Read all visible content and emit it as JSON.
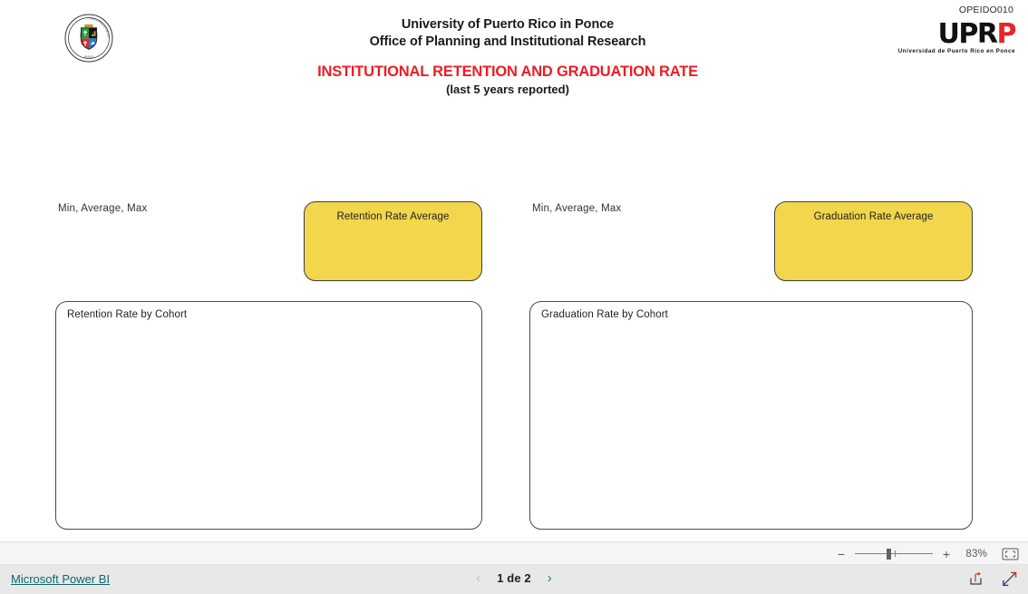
{
  "header": {
    "org_line_1": "University of Puerto Rico in Ponce",
    "org_line_2": "Office of Planning and Institutional Research",
    "report_title": "INSTITUTIONAL RETENTION AND GRADUATION RATE",
    "report_subtitle": "(last 5 years reported)",
    "opeid_code": "OPEIDO010",
    "title_color": "#ee1c25",
    "seal": {
      "icon": "university-seal-icon",
      "ring_text": "UNIVERSIDAD DE PUERTO RICO",
      "bottom_text": "PONCE"
    },
    "uprp_logo": {
      "text_black": "UPR",
      "text_red": "P",
      "tagline": "Universidad de Puerto Rico en Ponce",
      "black": "#111111",
      "red": "#e8232a"
    }
  },
  "visuals": {
    "retention": {
      "minmax_label": "Min, Average, Max",
      "kpi_title": "Retention Rate Average",
      "kpi_color": "#F2D64C",
      "chart_title": "Retention Rate by Cohort"
    },
    "graduation": {
      "minmax_label": "Min, Average, Max",
      "kpi_title": "Graduation Rate Average",
      "kpi_color": "#F2D64C",
      "chart_title": "Graduation Rate by Cohort"
    }
  },
  "zoom_bar": {
    "zoom_out_label": "−",
    "zoom_in_label": "+",
    "zoom_percent": "83%",
    "fit_page_icon": "fit-to-page-icon"
  },
  "footer": {
    "brand_link": "Microsoft Power BI",
    "prev_icon": "chevron-left-icon",
    "next_icon": "chevron-right-icon",
    "page_indicator": "1 de 2",
    "share_icon": "share-icon",
    "fullscreen_icon": "fullscreen-icon",
    "link_color": "#11686e"
  }
}
